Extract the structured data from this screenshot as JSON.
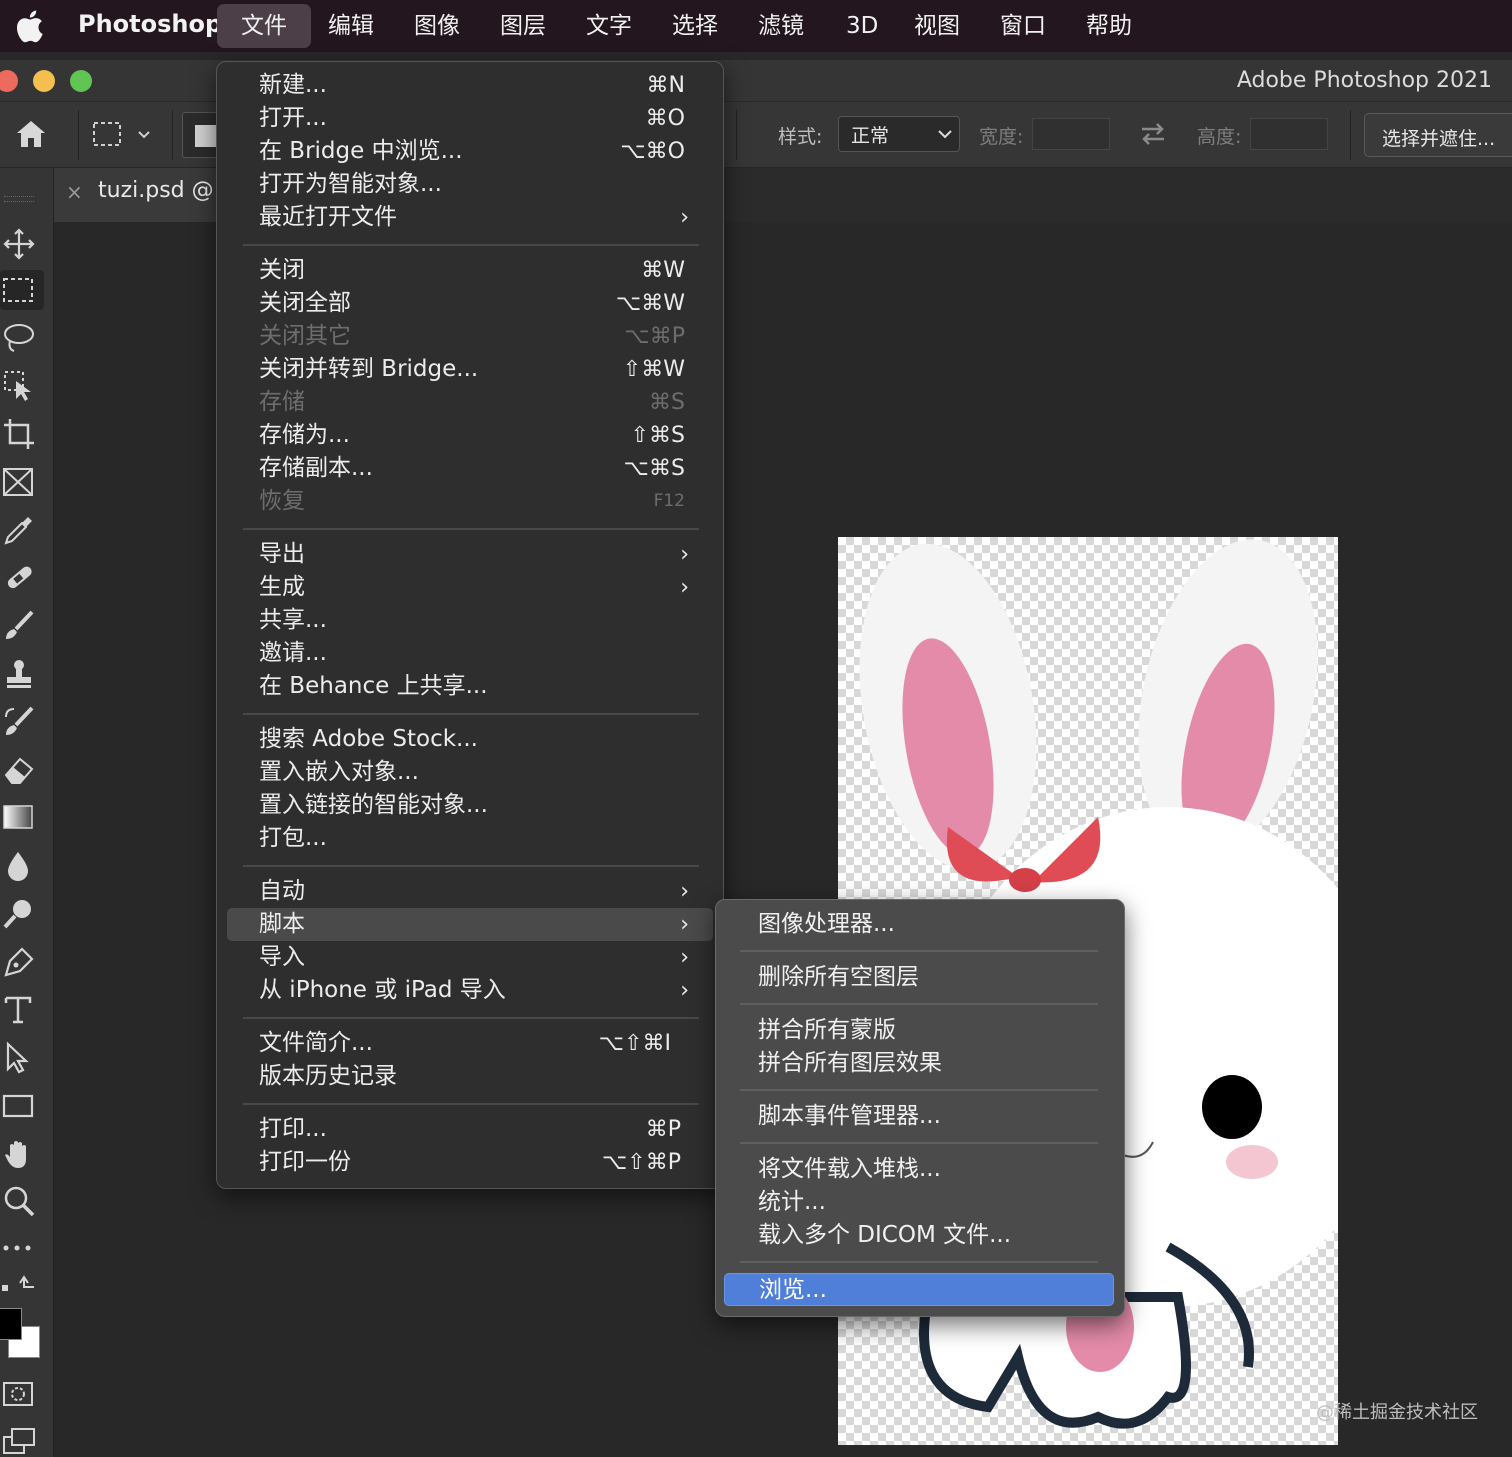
{
  "menubar": {
    "app_name": "Photoshop",
    "items": [
      "文件",
      "编辑",
      "图像",
      "图层",
      "文字",
      "选择",
      "滤镜",
      "3D",
      "视图",
      "窗口",
      "帮助"
    ]
  },
  "window": {
    "title": "Adobe Photoshop 2021"
  },
  "options_bar": {
    "style_label": "样式:",
    "style_value": "正常",
    "width_label": "宽度:",
    "height_label": "高度:",
    "select_mask_button": "选择并遮住..."
  },
  "document_tab": {
    "label": "tuzi.psd @"
  },
  "file_menu": {
    "items": [
      {
        "label": "新建...",
        "shortcut": "⌘N"
      },
      {
        "label": "打开...",
        "shortcut": "⌘O"
      },
      {
        "label": "在 Bridge 中浏览...",
        "shortcut": "⌥⌘O"
      },
      {
        "label": "打开为智能对象...",
        "shortcut": ""
      },
      {
        "label": "最近打开文件",
        "submenu": "›"
      },
      {
        "label": "关闭",
        "shortcut": "⌘W"
      },
      {
        "label": "关闭全部",
        "shortcut": "⌥⌘W"
      },
      {
        "label": "关闭其它",
        "shortcut": "⌥⌘P",
        "disabled": true
      },
      {
        "label": "关闭并转到 Bridge...",
        "shortcut": "⇧⌘W"
      },
      {
        "label": "存储",
        "shortcut": "⌘S",
        "disabled": true
      },
      {
        "label": "存储为...",
        "shortcut": "⇧⌘S"
      },
      {
        "label": "存储副本...",
        "shortcut": "⌥⌘S"
      },
      {
        "label": "恢复",
        "shortcut": "F12",
        "disabled": true
      },
      {
        "label": "导出",
        "submenu": "›"
      },
      {
        "label": "生成",
        "submenu": "›"
      },
      {
        "label": "共享...",
        "shortcut": ""
      },
      {
        "label": "邀请...",
        "shortcut": ""
      },
      {
        "label": "在 Behance 上共享...",
        "shortcut": ""
      },
      {
        "label": "搜索 Adobe Stock...",
        "shortcut": ""
      },
      {
        "label": "置入嵌入对象...",
        "shortcut": ""
      },
      {
        "label": "置入链接的智能对象...",
        "shortcut": ""
      },
      {
        "label": "打包...",
        "shortcut": ""
      },
      {
        "label": "自动",
        "submenu": "›"
      },
      {
        "label": "脚本",
        "submenu": "›",
        "highlighted": true
      },
      {
        "label": "导入",
        "submenu": "›"
      },
      {
        "label": "从 iPhone 或 iPad 导入",
        "submenu": "›"
      },
      {
        "label": "文件简介...",
        "shortcut": "⌥⇧⌘I"
      },
      {
        "label": "版本历史记录",
        "shortcut": ""
      },
      {
        "label": "打印...",
        "shortcut": "⌘P"
      },
      {
        "label": "打印一份",
        "shortcut": "⌥⇧⌘P"
      }
    ]
  },
  "scripts_submenu": {
    "items": [
      {
        "label": "图像处理器..."
      },
      {
        "label": "删除所有空图层"
      },
      {
        "label": "拼合所有蒙版"
      },
      {
        "label": "拼合所有图层效果"
      },
      {
        "label": "脚本事件管理器..."
      },
      {
        "label": "将文件载入堆栈..."
      },
      {
        "label": "统计..."
      },
      {
        "label": "载入多个 DICOM 文件..."
      },
      {
        "label": "浏览...",
        "selected": true
      }
    ]
  },
  "watermark": "@稀土掘金技术社区",
  "colors": {
    "menubar_bg": "#23161f",
    "panel_bg": "#353535",
    "menu_bg": "#2e2e2e",
    "submenu_bg": "#4b4b4b",
    "selection_blue": "#4f7fd9",
    "traffic_red": "#ed6a5e",
    "traffic_yellow": "#f5bf4f",
    "traffic_green": "#61c554"
  }
}
